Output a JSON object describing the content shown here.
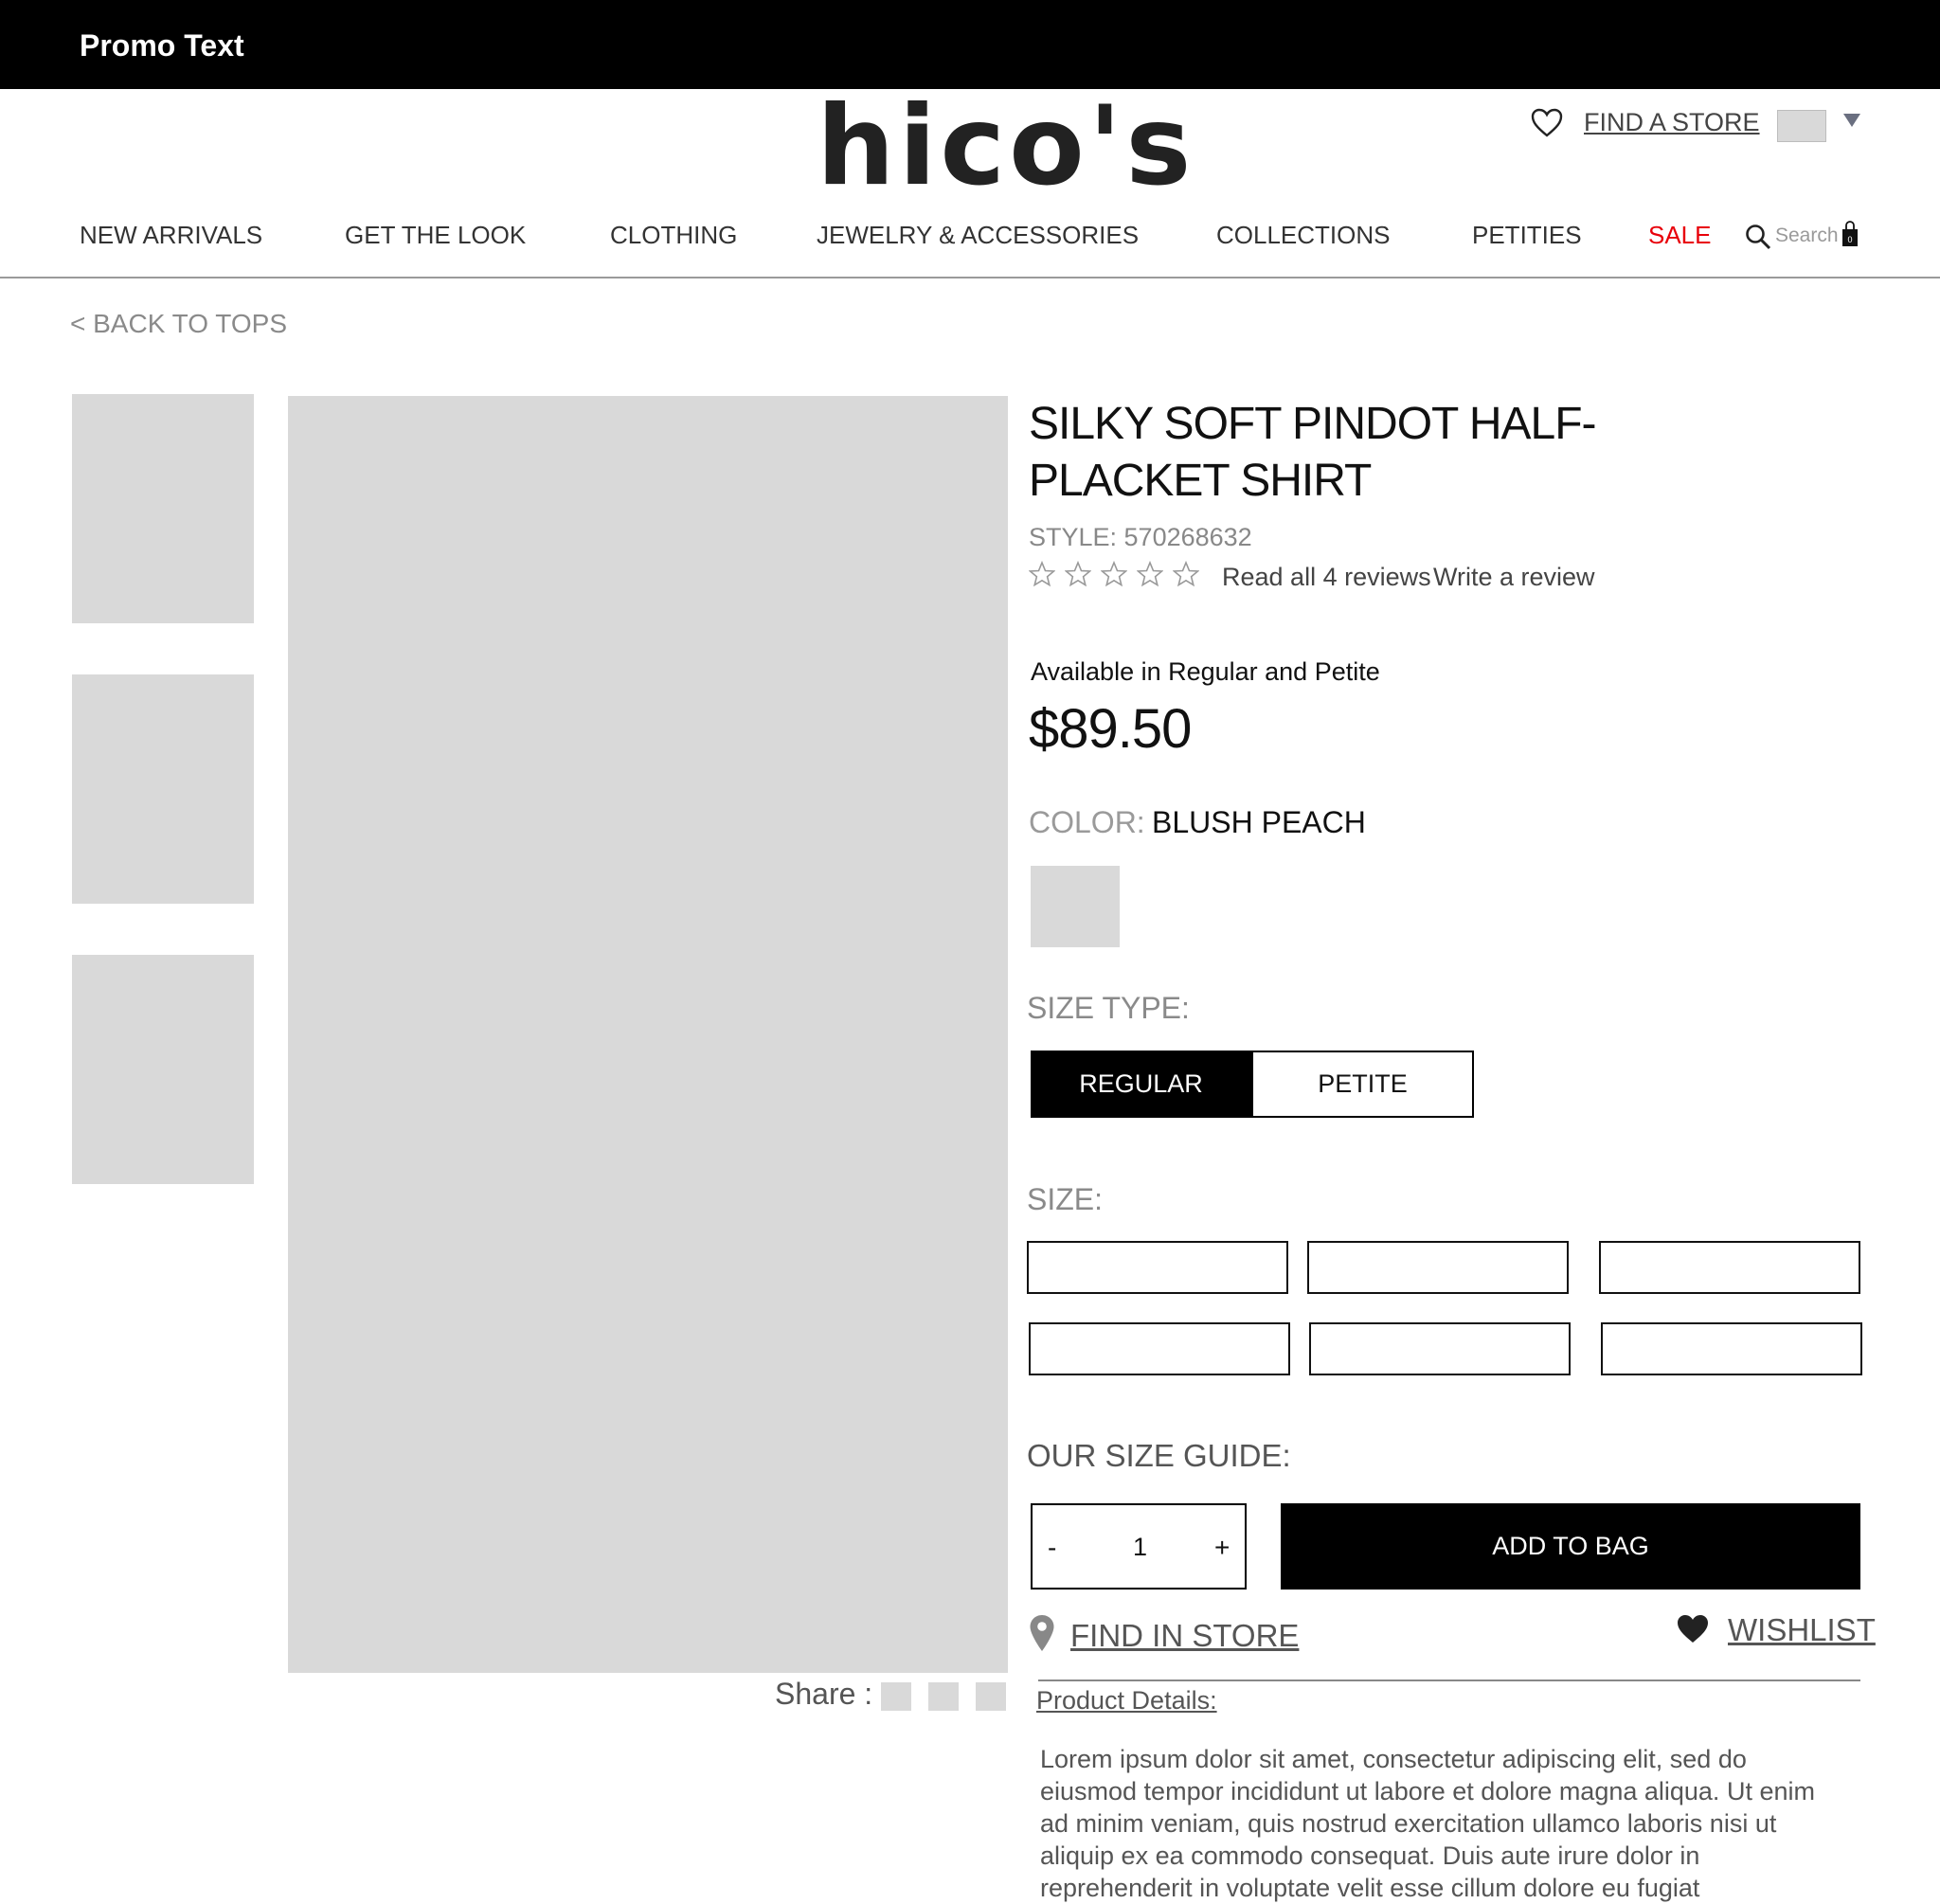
{
  "promo": {
    "text": "Promo Text"
  },
  "header": {
    "logo_text": "hico's",
    "find_store_label": "FIND A STORE",
    "icons": {
      "wishlist": "heart-outline-icon",
      "locale": "flag-icon",
      "locale_caret": "caret-down-icon"
    }
  },
  "nav": {
    "items": [
      {
        "label": "NEW ARRIVALS"
      },
      {
        "label": "GET THE LOOK"
      },
      {
        "label": "CLOTHING"
      },
      {
        "label": "JEWELRY & ACCESSORIES"
      },
      {
        "label": "COLLECTIONS"
      },
      {
        "label": "PETITIES"
      },
      {
        "label": "SALE"
      }
    ],
    "sale_color": "#e8000a",
    "search_label": "Search",
    "bag_count": "0"
  },
  "breadcrumb": {
    "back_label": "< BACK TO TOPS"
  },
  "share": {
    "label": "Share :"
  },
  "product": {
    "title": "SILKY SOFT PINDOT HALF-PLACKET SHIRT",
    "style": "STYLE: 570268632",
    "rating": {
      "value": 0,
      "max": 5
    },
    "read_reviews": "Read all 4 reviews",
    "write_review": "Write a review",
    "availability": "Available in Regular and Petite",
    "price": "$89.50",
    "color_label": "COLOR:",
    "color_value": "BLUSH PEACH",
    "size_type_label": "SIZE TYPE:",
    "size_types": [
      {
        "label": "REGULAR",
        "selected": true
      },
      {
        "label": "PETITE",
        "selected": false
      }
    ],
    "size_label": "SIZE:",
    "size_guide_label": "OUR SIZE GUIDE:",
    "quantity": {
      "minus": "-",
      "value": "1",
      "plus": "+"
    },
    "add_to_bag": "ADD TO BAG",
    "find_in_store": "FIND IN STORE",
    "wishlist": "WISHLIST",
    "details_label": "Product Details:",
    "details_text": "Lorem ipsum dolor sit amet, consectetur adipiscing elit, sed do eiusmod tempor incididunt ut labore et dolore magna aliqua. Ut enim ad minim veniam, quis nostrud exercitation ullamco laboris nisi ut aliquip ex ea commodo consequat. Duis aute irure dolor in reprehenderit in voluptate velit esse cillum dolore eu fugiat"
  }
}
